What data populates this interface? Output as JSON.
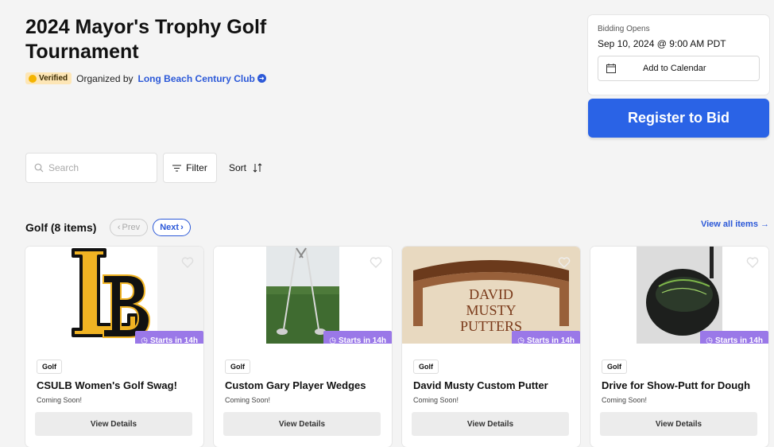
{
  "event": {
    "title": "2024 Mayor's Trophy Golf Tournament",
    "verified_label": "Verified",
    "organized_by_label": "Organized by",
    "organizer_name": "Long Beach Century Club"
  },
  "bidding": {
    "label": "Bidding Opens",
    "date": "Sep 10, 2024 @ 9:00 AM PDT",
    "calendar_button": "Add to Calendar",
    "register_button": "Register to Bid"
  },
  "toolbar": {
    "search_placeholder": "Search",
    "filter_label": "Filter",
    "sort_label": "Sort"
  },
  "section": {
    "title": "Golf (8 items)",
    "prev_label": "Prev",
    "next_label": "Next",
    "view_all_label": "View all items →"
  },
  "colors": {
    "accent_blue": "#2a63e6",
    "badge_purple": "#9a78e8",
    "verified_bg": "#fde6b6"
  },
  "items": [
    {
      "badge": "Starts in 14h",
      "category": "Golf",
      "title": "CSULB Women's Golf Swag!",
      "status": "Coming Soon!",
      "button": "View Details"
    },
    {
      "badge": "Starts in 14h",
      "category": "Golf",
      "title": "Custom Gary Player Wedges",
      "status": "Coming Soon!",
      "button": "View Details"
    },
    {
      "badge": "Starts in 14h",
      "category": "Golf",
      "title": "David Musty Custom Putter",
      "status": "Coming Soon!",
      "button": "View Details",
      "image_text": [
        "DAVID",
        "MUSTY",
        "PUTTERS"
      ]
    },
    {
      "badge": "Starts in 14h",
      "category": "Golf",
      "title": "Drive for Show-Putt for Dough",
      "status": "Coming Soon!",
      "button": "View Details"
    }
  ]
}
